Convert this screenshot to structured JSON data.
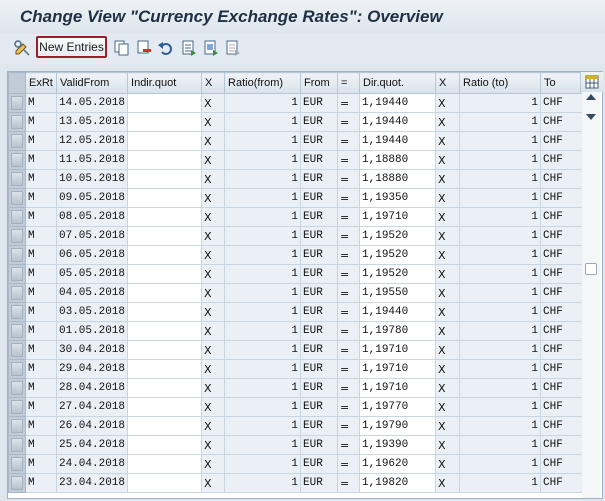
{
  "window": {
    "title": "Change View \"Currency Exchange Rates\": Overview"
  },
  "toolbar": {
    "new_entries_label": "New Entries",
    "icons": [
      "display-change-icon",
      "copy-icon",
      "delete-icon",
      "undo-icon",
      "select-all-icon",
      "select-block-icon",
      "deselect-all-icon"
    ]
  },
  "colors": {
    "highlight_border": "#9a1f2a",
    "header_bg": "#dde5ec",
    "readonly_cell": "#eaf0f5"
  },
  "table": {
    "columns": [
      "ExRt",
      "ValidFrom",
      "Indir.quot",
      "X",
      "Ratio(from)",
      "From",
      "=",
      "Dir.quot.",
      "X",
      "Ratio (to)",
      "To"
    ],
    "rows": [
      {
        "exrt": "M",
        "valid_from": "14.05.2018",
        "indir_quot": "",
        "x1": "X",
        "ratio_from": "1",
        "from": "EUR",
        "eq": "=",
        "dir_quot": "1,19440",
        "x2": "X",
        "ratio_to": "1",
        "to": "CHF"
      },
      {
        "exrt": "M",
        "valid_from": "13.05.2018",
        "indir_quot": "",
        "x1": "X",
        "ratio_from": "1",
        "from": "EUR",
        "eq": "=",
        "dir_quot": "1,19440",
        "x2": "X",
        "ratio_to": "1",
        "to": "CHF"
      },
      {
        "exrt": "M",
        "valid_from": "12.05.2018",
        "indir_quot": "",
        "x1": "X",
        "ratio_from": "1",
        "from": "EUR",
        "eq": "=",
        "dir_quot": "1,19440",
        "x2": "X",
        "ratio_to": "1",
        "to": "CHF"
      },
      {
        "exrt": "M",
        "valid_from": "11.05.2018",
        "indir_quot": "",
        "x1": "X",
        "ratio_from": "1",
        "from": "EUR",
        "eq": "=",
        "dir_quot": "1,18880",
        "x2": "X",
        "ratio_to": "1",
        "to": "CHF"
      },
      {
        "exrt": "M",
        "valid_from": "10.05.2018",
        "indir_quot": "",
        "x1": "X",
        "ratio_from": "1",
        "from": "EUR",
        "eq": "=",
        "dir_quot": "1,18880",
        "x2": "X",
        "ratio_to": "1",
        "to": "CHF"
      },
      {
        "exrt": "M",
        "valid_from": "09.05.2018",
        "indir_quot": "",
        "x1": "X",
        "ratio_from": "1",
        "from": "EUR",
        "eq": "=",
        "dir_quot": "1,19350",
        "x2": "X",
        "ratio_to": "1",
        "to": "CHF"
      },
      {
        "exrt": "M",
        "valid_from": "08.05.2018",
        "indir_quot": "",
        "x1": "X",
        "ratio_from": "1",
        "from": "EUR",
        "eq": "=",
        "dir_quot": "1,19710",
        "x2": "X",
        "ratio_to": "1",
        "to": "CHF"
      },
      {
        "exrt": "M",
        "valid_from": "07.05.2018",
        "indir_quot": "",
        "x1": "X",
        "ratio_from": "1",
        "from": "EUR",
        "eq": "=",
        "dir_quot": "1,19520",
        "x2": "X",
        "ratio_to": "1",
        "to": "CHF"
      },
      {
        "exrt": "M",
        "valid_from": "06.05.2018",
        "indir_quot": "",
        "x1": "X",
        "ratio_from": "1",
        "from": "EUR",
        "eq": "=",
        "dir_quot": "1,19520",
        "x2": "X",
        "ratio_to": "1",
        "to": "CHF"
      },
      {
        "exrt": "M",
        "valid_from": "05.05.2018",
        "indir_quot": "",
        "x1": "X",
        "ratio_from": "1",
        "from": "EUR",
        "eq": "=",
        "dir_quot": "1,19520",
        "x2": "X",
        "ratio_to": "1",
        "to": "CHF"
      },
      {
        "exrt": "M",
        "valid_from": "04.05.2018",
        "indir_quot": "",
        "x1": "X",
        "ratio_from": "1",
        "from": "EUR",
        "eq": "=",
        "dir_quot": "1,19550",
        "x2": "X",
        "ratio_to": "1",
        "to": "CHF"
      },
      {
        "exrt": "M",
        "valid_from": "03.05.2018",
        "indir_quot": "",
        "x1": "X",
        "ratio_from": "1",
        "from": "EUR",
        "eq": "=",
        "dir_quot": "1,19440",
        "x2": "X",
        "ratio_to": "1",
        "to": "CHF"
      },
      {
        "exrt": "M",
        "valid_from": "01.05.2018",
        "indir_quot": "",
        "x1": "X",
        "ratio_from": "1",
        "from": "EUR",
        "eq": "=",
        "dir_quot": "1,19780",
        "x2": "X",
        "ratio_to": "1",
        "to": "CHF"
      },
      {
        "exrt": "M",
        "valid_from": "30.04.2018",
        "indir_quot": "",
        "x1": "X",
        "ratio_from": "1",
        "from": "EUR",
        "eq": "=",
        "dir_quot": "1,19710",
        "x2": "X",
        "ratio_to": "1",
        "to": "CHF"
      },
      {
        "exrt": "M",
        "valid_from": "29.04.2018",
        "indir_quot": "",
        "x1": "X",
        "ratio_from": "1",
        "from": "EUR",
        "eq": "=",
        "dir_quot": "1,19710",
        "x2": "X",
        "ratio_to": "1",
        "to": "CHF"
      },
      {
        "exrt": "M",
        "valid_from": "28.04.2018",
        "indir_quot": "",
        "x1": "X",
        "ratio_from": "1",
        "from": "EUR",
        "eq": "=",
        "dir_quot": "1,19710",
        "x2": "X",
        "ratio_to": "1",
        "to": "CHF"
      },
      {
        "exrt": "M",
        "valid_from": "27.04.2018",
        "indir_quot": "",
        "x1": "X",
        "ratio_from": "1",
        "from": "EUR",
        "eq": "=",
        "dir_quot": "1,19770",
        "x2": "X",
        "ratio_to": "1",
        "to": "CHF"
      },
      {
        "exrt": "M",
        "valid_from": "26.04.2018",
        "indir_quot": "",
        "x1": "X",
        "ratio_from": "1",
        "from": "EUR",
        "eq": "=",
        "dir_quot": "1,19790",
        "x2": "X",
        "ratio_to": "1",
        "to": "CHF"
      },
      {
        "exrt": "M",
        "valid_from": "25.04.2018",
        "indir_quot": "",
        "x1": "X",
        "ratio_from": "1",
        "from": "EUR",
        "eq": "=",
        "dir_quot": "1,19390",
        "x2": "X",
        "ratio_to": "1",
        "to": "CHF"
      },
      {
        "exrt": "M",
        "valid_from": "24.04.2018",
        "indir_quot": "",
        "x1": "X",
        "ratio_from": "1",
        "from": "EUR",
        "eq": "=",
        "dir_quot": "1,19620",
        "x2": "X",
        "ratio_to": "1",
        "to": "CHF"
      },
      {
        "exrt": "M",
        "valid_from": "23.04.2018",
        "indir_quot": "",
        "x1": "X",
        "ratio_from": "1",
        "from": "EUR",
        "eq": "=",
        "dir_quot": "1,19820",
        "x2": "X",
        "ratio_to": "1",
        "to": "CHF"
      }
    ]
  },
  "scrollbar": {
    "position": 0.38
  }
}
